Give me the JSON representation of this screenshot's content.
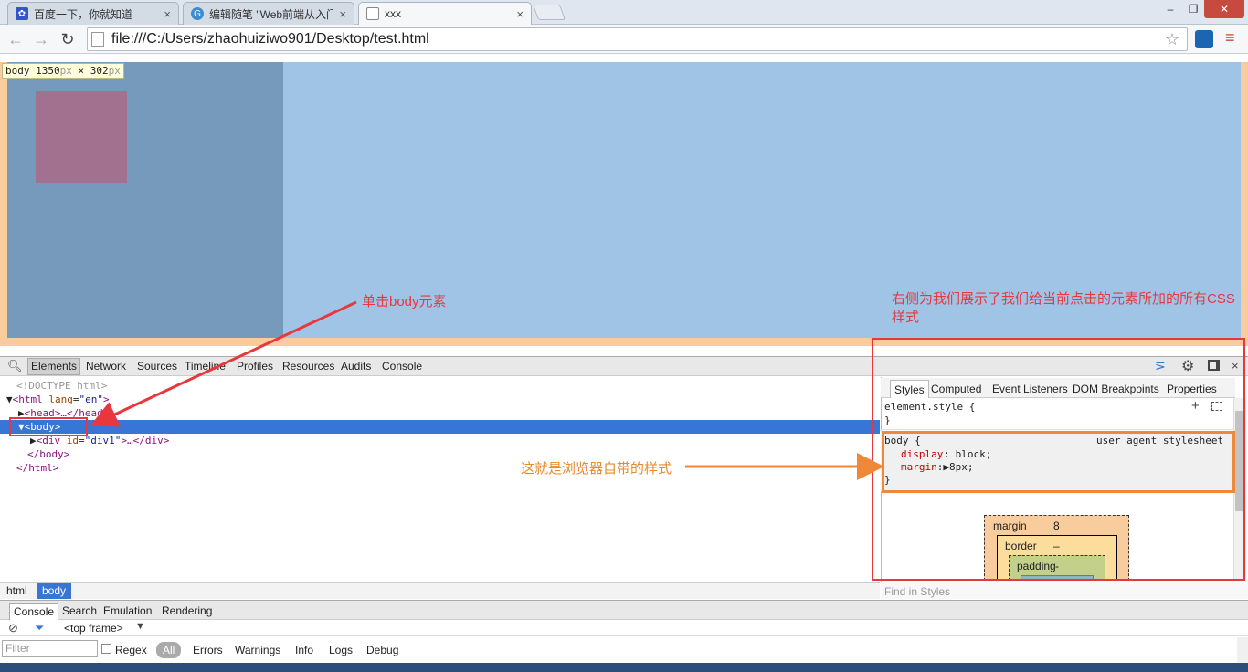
{
  "browser": {
    "tabs": [
      {
        "title": "百度一下，你就知道",
        "icon": "baidu-paw-icon",
        "active": false
      },
      {
        "title": "编辑随笔 \"Web前端从入门",
        "icon": "cnblogs-icon",
        "active": false
      },
      {
        "title": "xxx",
        "icon": "page-icon",
        "active": true
      }
    ],
    "tab_close_glyph": "×",
    "url": "file:///C:/Users/zhaohuiziwo901/Desktop/test.html",
    "window_controls": {
      "minimize": "–",
      "maximize": "❐",
      "close": "✕"
    }
  },
  "viewport": {
    "tooltip": {
      "tag": "body",
      "width": "1350",
      "height": "302",
      "unit": "px",
      "times": "×"
    },
    "colors": {
      "margin": "#f9cc9d",
      "content": "#a0c4e6",
      "div": "#759abb",
      "inner": "#a1718f"
    }
  },
  "annotations": {
    "click_body": "单击body元素",
    "right_side": "右侧为我们展示了我们给当前点击的元素所加的所有CSS样式",
    "browser_default": "这就是浏览器自带的样式"
  },
  "devtools": {
    "tabs": [
      "Elements",
      "Network",
      "Sources",
      "Timeline",
      "Profiles",
      "Resources",
      "Audits",
      "Console"
    ],
    "selected_tab": "Elements",
    "dom": {
      "doctype": "<!DOCTYPE html>",
      "html_open_tag": "<html",
      "html_attr": "lang",
      "html_attr_val": "\"en\"",
      "html_close_bracket": ">",
      "head": "<head>…</head>",
      "body_open": "<body>",
      "div_open_tag": "<div",
      "div_attr": "id",
      "div_attr_val": "\"div1\"",
      "div_rest": ">…</div>",
      "body_close": "</body>",
      "html_close": "</html>"
    },
    "breadcrumbs": [
      "html",
      "body"
    ],
    "sidebar_tabs": [
      "Styles",
      "Computed",
      "Event Listeners",
      "DOM Breakpoints",
      "Properties"
    ],
    "styles": {
      "element_style": "element.style {",
      "close_brace": "}",
      "body_selector": "body {",
      "source": "user agent stylesheet",
      "props": [
        {
          "name": "display",
          "value": "block;"
        },
        {
          "name": "margin",
          "value": "8px;"
        }
      ]
    },
    "box_model": {
      "margin_label": "margin",
      "margin_value": "8",
      "border_label": "border",
      "border_value": "–",
      "padding_label": "padding",
      "padding_value": "-"
    },
    "find_in_styles": "Find in Styles"
  },
  "drawer": {
    "tabs": [
      "Console",
      "Search",
      "Emulation",
      "Rendering"
    ],
    "frame": "<top frame>",
    "filter_placeholder": "Filter",
    "regex_label": "Regex",
    "levels": [
      "All",
      "Errors",
      "Warnings",
      "Info",
      "Logs",
      "Debug"
    ]
  }
}
